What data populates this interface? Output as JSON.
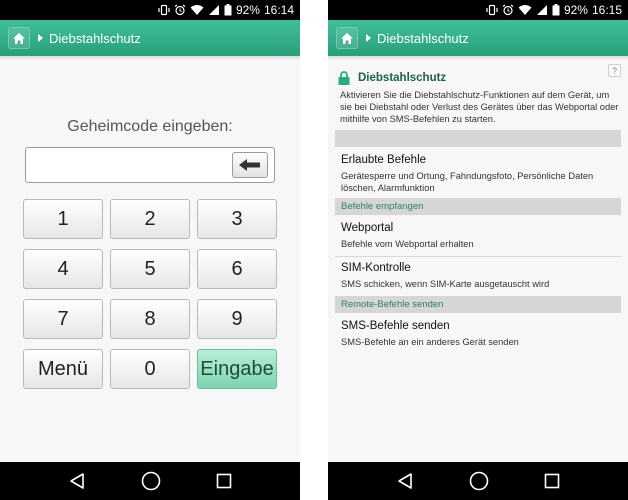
{
  "status_left": {
    "battery": "92%",
    "time": "16:14"
  },
  "status_right": {
    "battery": "92%",
    "time": "16:15"
  },
  "breadcrumb": "Diebstahlschutz",
  "keypad_screen": {
    "code_label": "Geheimcode eingeben:",
    "code_value": "",
    "keys": [
      "1",
      "2",
      "3",
      "4",
      "5",
      "6",
      "7",
      "8",
      "9",
      "Menü",
      "0",
      "Eingabe"
    ]
  },
  "settings_screen": {
    "help": "?",
    "intro_title": "Diebstahlschutz",
    "intro_text": "Aktivieren Sie die Diebstahlschutz-Funktionen auf dem Gerät, um sie bei Diebstahl oder Verlust des Gerätes über das Webportal oder mithilfe von SMS-Befehlen zu starten.",
    "allowed": {
      "title": "Erlaubte Befehle",
      "desc": "Gerätesperre und Ortung, Fahndungsfoto, Persönliche Daten löschen, Alarmfunktion"
    },
    "section_receive": "Befehle empfangen",
    "webportal": {
      "title": "Webportal",
      "desc": "Befehle vom Webportal erhalten"
    },
    "sim": {
      "title": "SIM-Kontrolle",
      "desc": "SMS schicken, wenn SIM-Karte ausgetauscht wird"
    },
    "section_remote": "Remote-Befehle senden",
    "sms": {
      "title": "SMS-Befehle senden",
      "desc": "SMS-Befehle an ein anderes Gerät senden"
    }
  },
  "icons": {
    "status": [
      "vibrate-icon",
      "alarm-icon",
      "wifi-icon",
      "signal-icon",
      "battery-icon"
    ],
    "nav": [
      "back-icon",
      "home-circle-icon",
      "recents-icon"
    ],
    "appbar": "home-icon",
    "lock": "lock-icon"
  },
  "colors": {
    "accent": "#2ea985",
    "section_text": "#2e7e64",
    "title_text": "#1f5f4c"
  }
}
